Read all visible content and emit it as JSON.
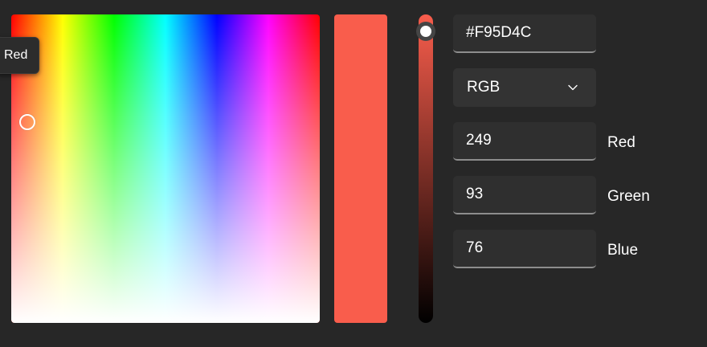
{
  "tooltip": {
    "text": "Red"
  },
  "color": {
    "hex": "#F95D4C",
    "preview_color": "#F95D4C",
    "brightness_fraction": 1.0
  },
  "mode": {
    "selected": "RGB",
    "icon": "chevron-down-icon"
  },
  "channels": [
    {
      "value": "249",
      "label": "Red"
    },
    {
      "value": "93",
      "label": "Green"
    },
    {
      "value": "76",
      "label": "Blue"
    }
  ]
}
